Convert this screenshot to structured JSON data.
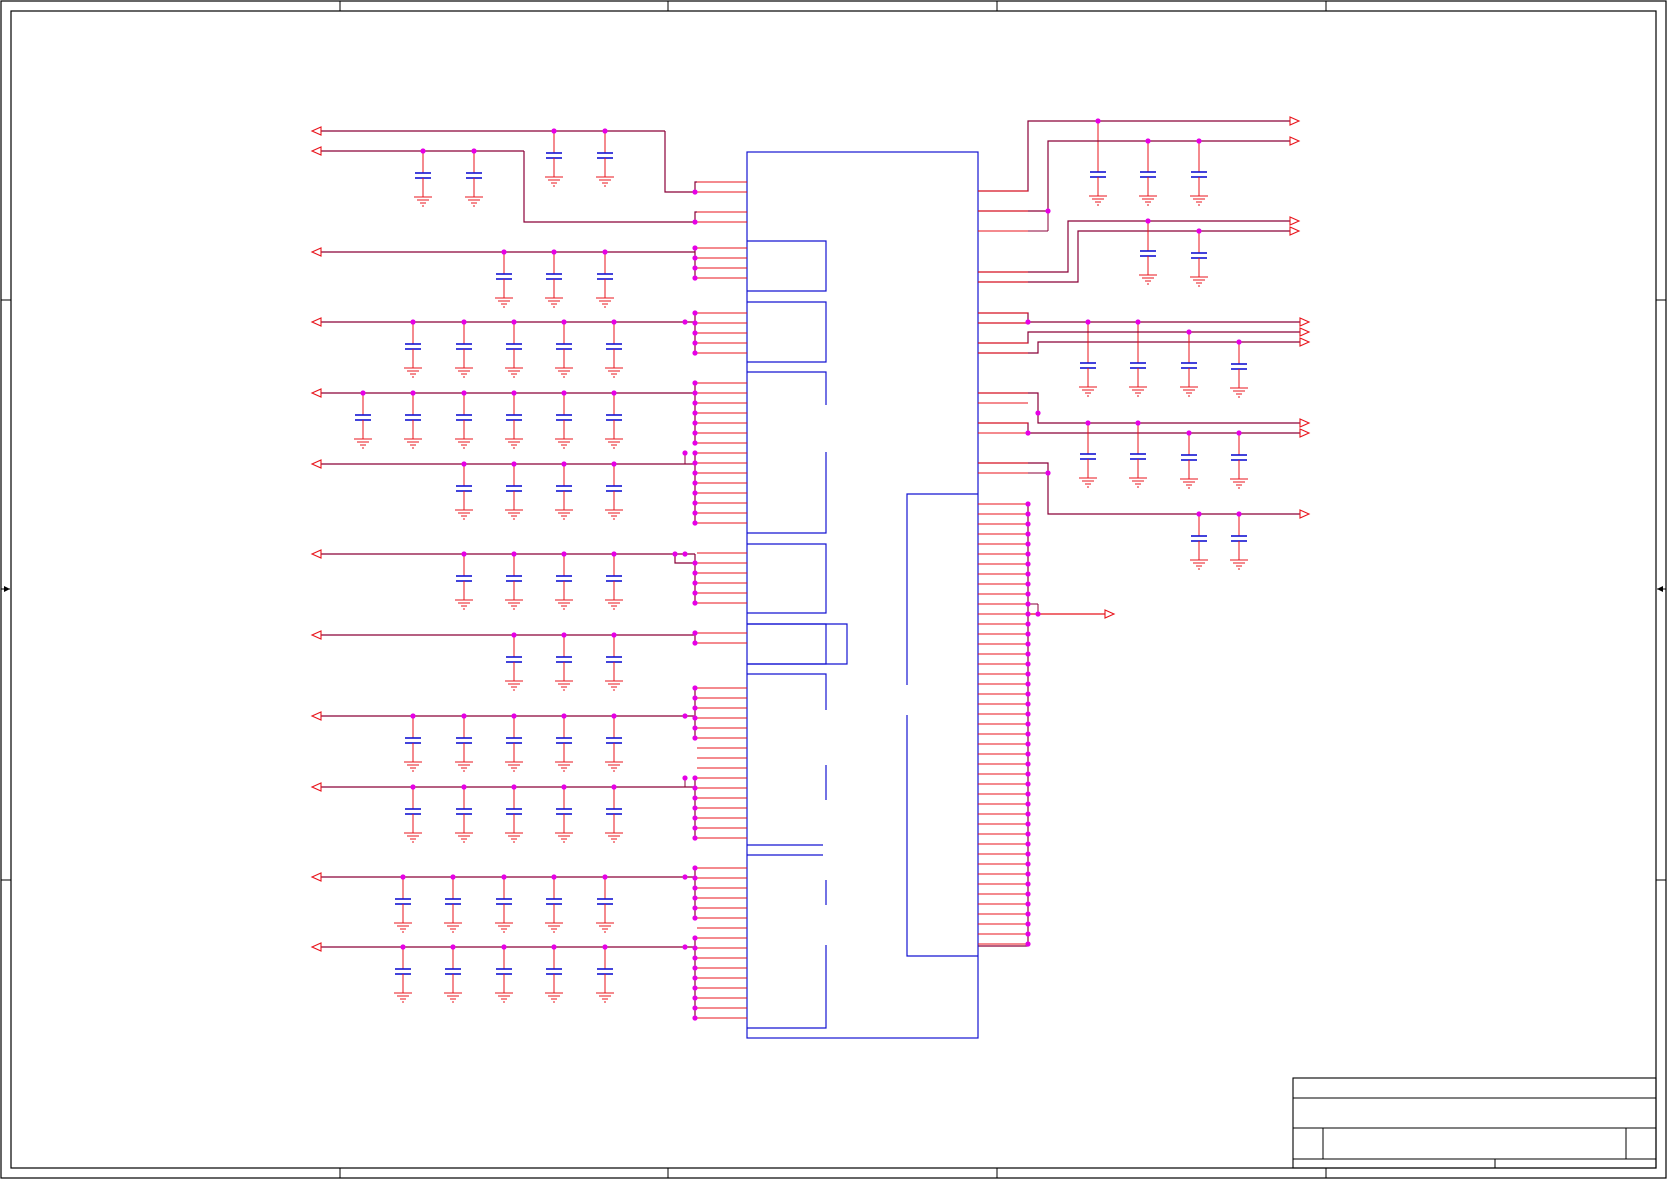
{
  "sheet": {
    "border_color": "#000000",
    "wire_color": "#8b0038",
    "pin_color": "#e8141c",
    "symbol_color": "#1414d2",
    "junction_color": "#e600e6",
    "ground_color": "#e8141c"
  },
  "title_block": {
    "title": "",
    "sheet_number": "",
    "revision": ""
  },
  "components": {
    "main_ic": "ic-symbol",
    "capacitor": "capacitor-symbol",
    "ground": "ground-icon",
    "port_in": "input-port-icon",
    "port_out": "output-port-icon"
  }
}
